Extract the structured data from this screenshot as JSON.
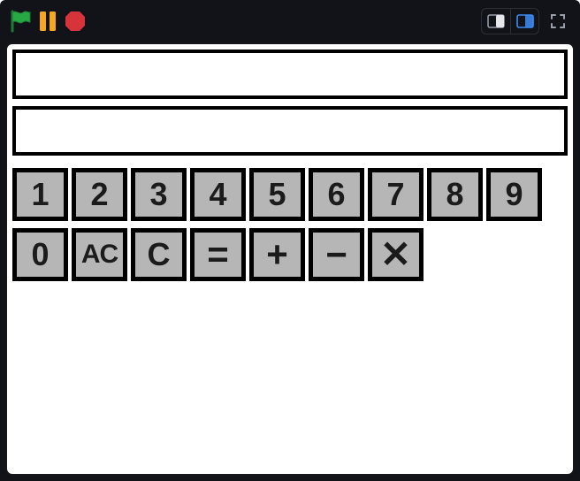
{
  "topbar": {
    "flag_color": "#27a844",
    "pause_color": "#f5a623",
    "stop_color": "#d6333b"
  },
  "display": {
    "line1": "",
    "line2": ""
  },
  "keys": {
    "row1": [
      {
        "name": "key-1",
        "label": "1"
      },
      {
        "name": "key-2",
        "label": "2"
      },
      {
        "name": "key-3",
        "label": "3"
      },
      {
        "name": "key-4",
        "label": "4"
      },
      {
        "name": "key-5",
        "label": "5"
      },
      {
        "name": "key-6",
        "label": "6"
      },
      {
        "name": "key-7",
        "label": "7"
      },
      {
        "name": "key-8",
        "label": "8"
      },
      {
        "name": "key-9",
        "label": "9"
      }
    ],
    "row2": [
      {
        "name": "key-0",
        "label": "0",
        "cls": ""
      },
      {
        "name": "key-ac",
        "label": "AC",
        "cls": "ac"
      },
      {
        "name": "key-c",
        "label": "C",
        "cls": ""
      },
      {
        "name": "key-equals",
        "label": "=",
        "cls": "sym"
      },
      {
        "name": "key-plus",
        "label": "+",
        "cls": "sym"
      },
      {
        "name": "key-minus",
        "label": "−",
        "cls": "sym"
      },
      {
        "name": "key-multiply",
        "label": "✕",
        "cls": "sym"
      }
    ]
  }
}
